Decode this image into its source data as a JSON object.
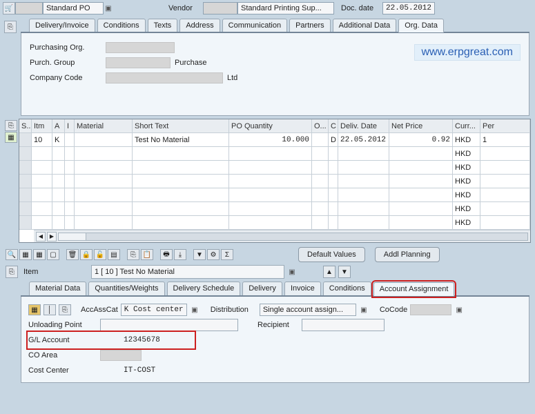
{
  "header": {
    "doc_type": "Standard PO",
    "vendor_label": "Vendor",
    "vendor_name": "Standard Printing Sup...",
    "doc_date_label": "Doc. date",
    "doc_date": "22.05.2012"
  },
  "tabs_header": {
    "t0": "Delivery/Invoice",
    "t1": "Conditions",
    "t2": "Texts",
    "t3": "Address",
    "t4": "Communication",
    "t5": "Partners",
    "t6": "Additional Data",
    "t7": "Org. Data"
  },
  "org": {
    "purchasing_org_label": "Purchasing Org.",
    "purch_group_label": "Purch. Group",
    "purch_group_text": "Purchase",
    "company_code_label": "Company Code",
    "company_code_text": "Ltd"
  },
  "watermark": "www.erpgreat.com",
  "grid": {
    "cols": {
      "s": "S...",
      "itm": "Itm",
      "a": "A",
      "i": "I",
      "material": "Material",
      "short": "Short Text",
      "po_qty": "PO Quantity",
      "o": "O...",
      "c": "C",
      "deliv": "Deliv. Date",
      "net": "Net Price",
      "curr": "Curr...",
      "per": "Per"
    },
    "row1": {
      "itm": "10",
      "a": "K",
      "short": "Test No Material",
      "qty": "10.000",
      "c": "D",
      "deliv": "22.05.2012",
      "net": "0.92",
      "curr": "HKD",
      "per": "1"
    },
    "curr": "HKD"
  },
  "buttons": {
    "default_values": "Default Values",
    "addl_planning": "Addl Planning"
  },
  "item_section": {
    "label": "Item",
    "value": "1 [ 10 ] Test No Material"
  },
  "tabs_item": {
    "t0": "Material Data",
    "t1": "Quantities/Weights",
    "t2": "Delivery Schedule",
    "t3": "Delivery",
    "t4": "Invoice",
    "t5": "Conditions",
    "t6": "Account Assignment"
  },
  "acct": {
    "accasscat_label": "AccAssCat",
    "accasscat_value": "K Cost center",
    "distribution_label": "Distribution",
    "distribution_value": "Single account assign...",
    "cocode_label": "CoCode",
    "unloading_label": "Unloading Point",
    "recipient_label": "Recipient",
    "gl_label": "G/L Account",
    "gl_value": "12345678",
    "co_area_label": "CO Area",
    "cost_center_label": "Cost Center",
    "cost_center_value": "IT-COST"
  }
}
